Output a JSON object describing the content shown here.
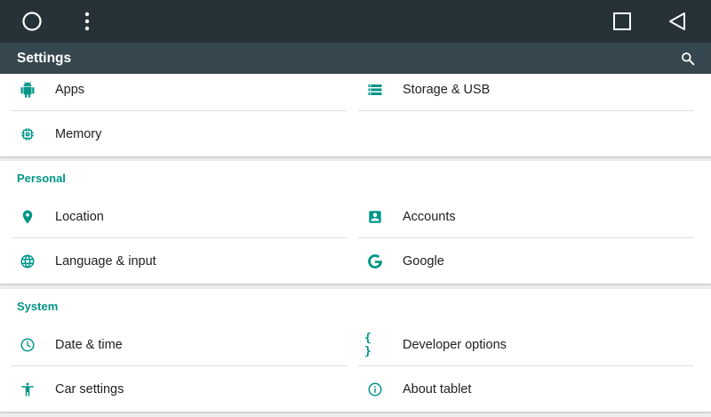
{
  "appbar": {
    "title": "Settings"
  },
  "device": {
    "items": [
      {
        "label": "Apps",
        "icon": "android-icon"
      },
      {
        "label": "Storage & USB",
        "icon": "storage-icon"
      },
      {
        "label": "Memory",
        "icon": "memory-icon"
      }
    ]
  },
  "personal": {
    "title": "Personal",
    "items": [
      {
        "label": "Location",
        "icon": "location-pin-icon"
      },
      {
        "label": "Accounts",
        "icon": "accounts-icon"
      },
      {
        "label": "Language & input",
        "icon": "globe-icon"
      },
      {
        "label": "Google",
        "icon": "google-g-icon"
      }
    ]
  },
  "system": {
    "title": "System",
    "items": [
      {
        "label": "Date & time",
        "icon": "clock-icon"
      },
      {
        "label": "Developer options",
        "icon": "braces-icon",
        "glyph": "{ }"
      },
      {
        "label": "Car settings",
        "icon": "accessibility-icon"
      },
      {
        "label": "About tablet",
        "icon": "info-icon"
      }
    ]
  },
  "colors": {
    "accent": "#009688",
    "appbar": "#37474f",
    "navbar": "#263238",
    "background": "#eeeeee"
  }
}
